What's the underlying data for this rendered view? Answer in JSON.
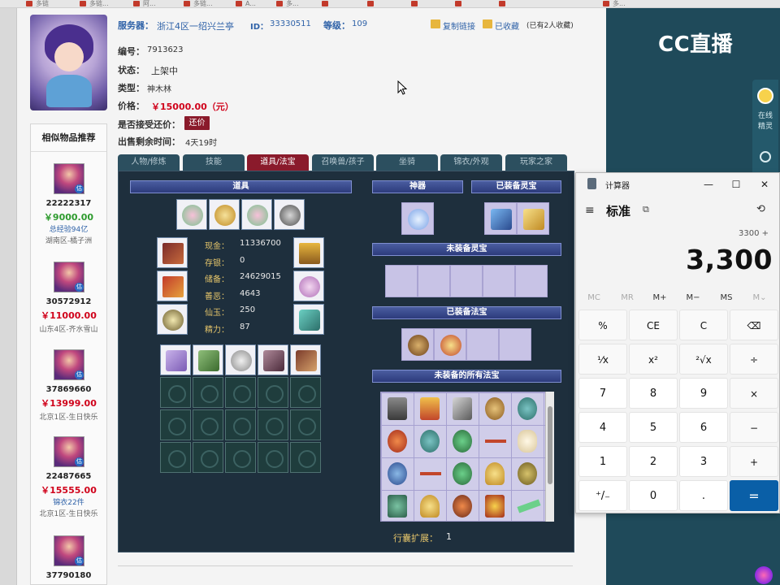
{
  "browser": {
    "bookmarks": [
      "多链",
      "多链...",
      "阿...",
      "多链...",
      "A...",
      "多...",
      "...",
      "...",
      "电...",
      "多...",
      "..."
    ]
  },
  "header": {
    "server_label": "服务器：",
    "server_value": "浙江4区一绍兴兰亭",
    "id_label": "ID：",
    "id_value": "33330511",
    "level_label": "等级：",
    "level_value": "109",
    "copy_link": "复制链接",
    "favorited": "已收藏",
    "fav_count": "(已有2人收藏)"
  },
  "info": {
    "number_label": "编号：",
    "number_value": "7913623",
    "status_label": "状态：",
    "status_value": "上架中",
    "type_label": "类型：",
    "type_value": "神木林",
    "price_label": "价格：",
    "price_value": "￥15000.00（元）",
    "haggle_label": "是否接受还价：",
    "haggle_button": "还价",
    "remaining_label": "出售剩余时间：",
    "remaining_value": "4天19时"
  },
  "similar": {
    "title": "相似物品推荐",
    "items": [
      {
        "id": "22222317",
        "price": "￥9000.00",
        "price_color": "#2e9b2e",
        "note": "总经验94亿",
        "server": "湖南区-橘子洲"
      },
      {
        "id": "30572912",
        "price": "￥11000.00",
        "price_color": "#d0021b",
        "note": "",
        "server": "山东4区-齐水雪山"
      },
      {
        "id": "37869660",
        "price": "￥13999.00",
        "price_color": "#d0021b",
        "note": "",
        "server": "北京1区-生日快乐"
      },
      {
        "id": "22487665",
        "price": "￥15555.00",
        "price_color": "#d0021b",
        "note": "锦衣22件",
        "server": "北京1区-生日快乐"
      },
      {
        "id": "37790180",
        "price": "",
        "price_color": "#d0021b",
        "note": "",
        "server": ""
      }
    ]
  },
  "tabs": [
    {
      "label": "人物/修炼",
      "active": false
    },
    {
      "label": "技能",
      "active": false
    },
    {
      "label": "道具/法宝",
      "active": true
    },
    {
      "label": "召唤兽/孩子",
      "active": false
    },
    {
      "label": "坐骑",
      "active": false
    },
    {
      "label": "锦衣/外观",
      "active": false
    },
    {
      "label": "玩家之家",
      "active": false
    }
  ],
  "panel": {
    "items_title": "道具",
    "artifact_title": "神器",
    "equipped_spirit_title": "已装备灵宝",
    "unequipped_spirit_title": "未装备灵宝",
    "equipped_magic_title": "已装备法宝",
    "unequipped_magic_title": "未装备的所有法宝",
    "stats": [
      {
        "k": "现金：",
        "v": "11336700"
      },
      {
        "k": "存银：",
        "v": "0"
      },
      {
        "k": "储备：",
        "v": "24629015"
      },
      {
        "k": "善恶：",
        "v": "4643"
      },
      {
        "k": "仙玉：",
        "v": "250"
      },
      {
        "k": "精力：",
        "v": "87"
      }
    ],
    "bag_ext_label": "行囊扩展：",
    "bag_ext_value": "1"
  },
  "cc": {
    "logo": "CC直播",
    "side_online": "在线",
    "side_elf": "精灵"
  },
  "calculator": {
    "title": "计算器",
    "mode": "标准",
    "expression": "3300 +",
    "display": "3,300",
    "memory": [
      "MC",
      "MR",
      "M+",
      "M−",
      "MS",
      "M⌄"
    ],
    "keys": [
      [
        "%",
        "CE",
        "C",
        "⌫"
      ],
      [
        "¹⁄x",
        "x²",
        "²√x",
        "÷"
      ],
      [
        "7",
        "8",
        "9",
        "×"
      ],
      [
        "4",
        "5",
        "6",
        "−"
      ],
      [
        "1",
        "2",
        "3",
        "+"
      ],
      [
        "⁺/₋",
        "0",
        ".",
        "="
      ]
    ]
  }
}
